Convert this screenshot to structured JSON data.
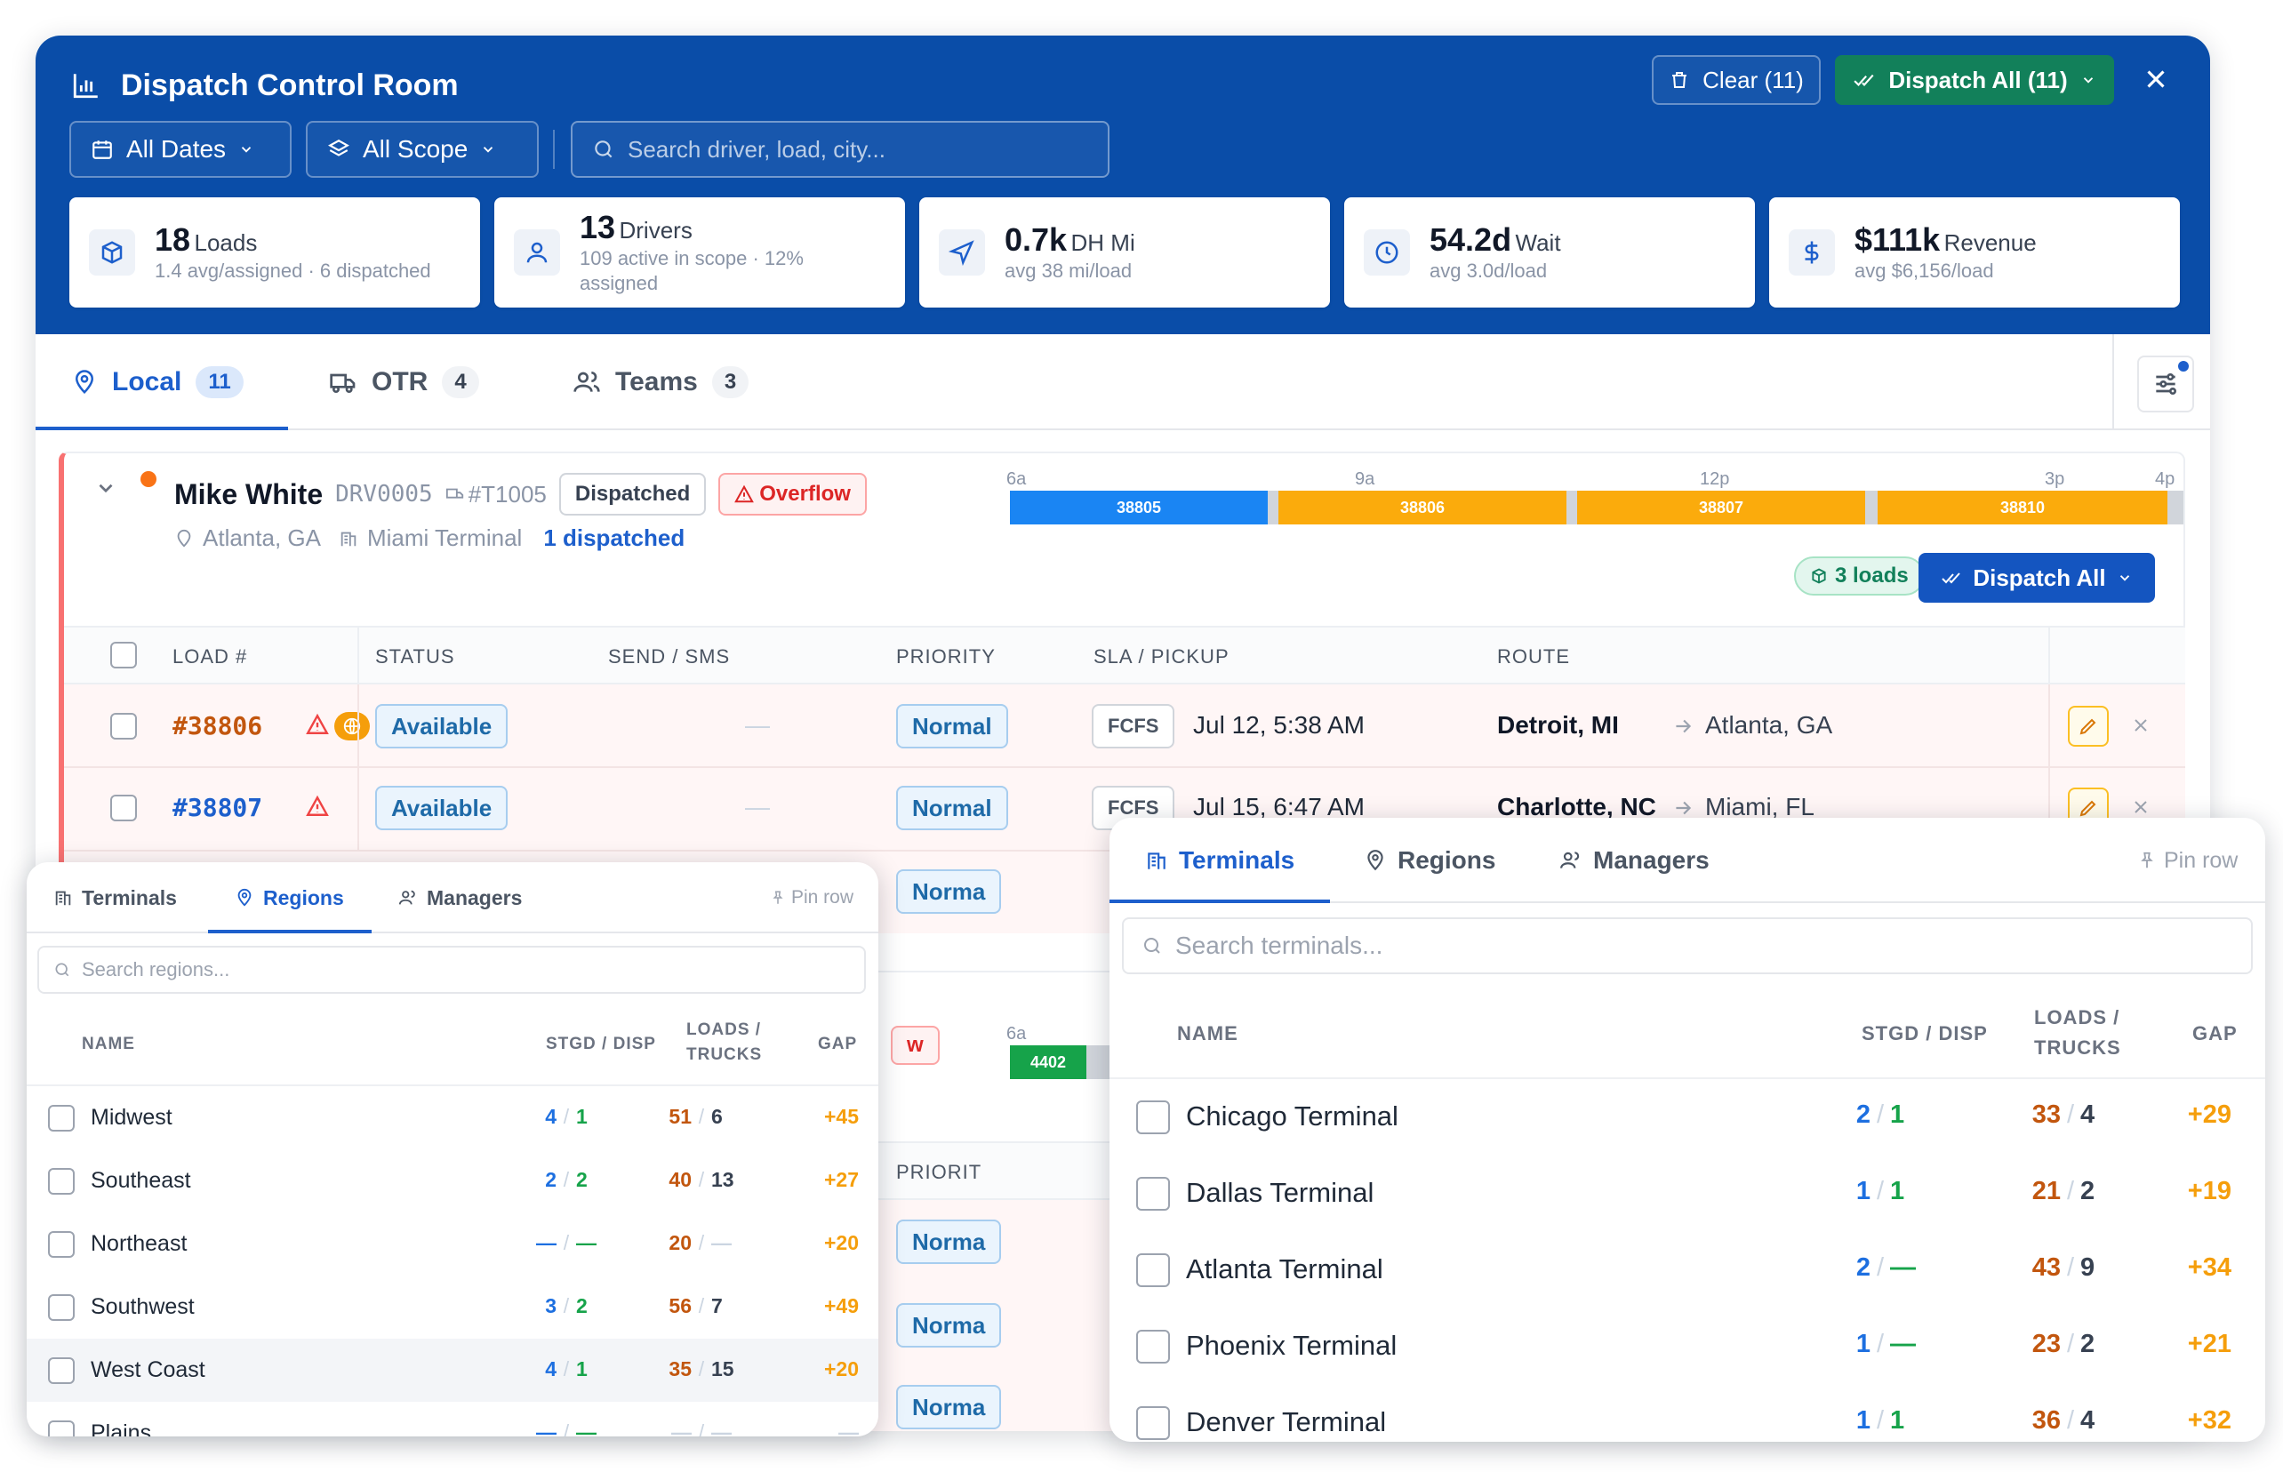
{
  "window": {
    "title": "Dispatch Control Room",
    "clear_label": "Clear (11)",
    "dispatch_all_label": "Dispatch All (11)"
  },
  "filters": {
    "dates": "All Dates",
    "scope": "All Scope",
    "search_placeholder": "Search driver, load, city..."
  },
  "stats": [
    {
      "value": "18",
      "label": "Loads",
      "sub": "1.4 avg/assigned · 6 dispatched",
      "icon": "box-icon"
    },
    {
      "value": "13",
      "label": "Drivers",
      "sub": "109 active in scope · 12% assigned",
      "icon": "user-icon"
    },
    {
      "value": "0.7k",
      "label": "DH Mi",
      "sub": "avg 38 mi/load",
      "icon": "navigation-icon"
    },
    {
      "value": "54.2d",
      "label": "Wait",
      "sub": "avg 3.0d/load",
      "icon": "clock-icon"
    },
    {
      "value": "$111k",
      "label": "Revenue",
      "sub": "avg $6,156/load",
      "icon": "dollar-icon"
    }
  ],
  "tabs": [
    {
      "label": "Local",
      "count": "11"
    },
    {
      "label": "OTR",
      "count": "4"
    },
    {
      "label": "Teams",
      "count": "3"
    }
  ],
  "driver": {
    "name": "Mike White",
    "id": "DRV0005",
    "truck": "#T1005",
    "status": "Dispatched",
    "flag": "Overflow",
    "city": "Atlanta, GA",
    "terminal": "Miami Terminal",
    "dispatched": "1 dispatched",
    "loads_badge": "3 loads",
    "dispatch_all": "Dispatch All"
  },
  "timeline": {
    "ticks": [
      "6a",
      "9a",
      "12p",
      "3p",
      "4p"
    ],
    "segments": [
      {
        "label": "38805",
        "color": "#1a85f3"
      },
      {
        "label": "38806",
        "color": "#fbab0c"
      },
      {
        "label": "38807",
        "color": "#fbab0c"
      },
      {
        "label": "38810",
        "color": "#fbab0c"
      }
    ]
  },
  "table": {
    "headers": [
      "LOAD #",
      "STATUS",
      "SEND / SMS",
      "PRIORITY",
      "SLA / PICKUP",
      "ROUTE"
    ],
    "rows": [
      {
        "load": "#38806",
        "status": "Available",
        "sms": "—",
        "priority": "Normal",
        "sla": "FCFS",
        "pickup": "Jul 12, 5:38 AM",
        "from": "Detroit, MI",
        "to": "Atlanta, GA"
      },
      {
        "load": "#38807",
        "status": "Available",
        "sms": "—",
        "priority": "Normal",
        "sla": "FCFS",
        "pickup": "Jul 15, 6:47 AM",
        "from": "Charlotte, NC",
        "to": "Miami, FL"
      }
    ],
    "hidden_priority": [
      "Norma",
      "Norma",
      "Norma",
      "Norma"
    ],
    "priority_hdr2": "PRIORIT"
  },
  "second_driver": {
    "tick": "6a",
    "segment": "4402",
    "flag_fragment": "w"
  },
  "regions_panel": {
    "tabs": [
      "Terminals",
      "Regions",
      "Managers"
    ],
    "pin": "Pin row",
    "search_placeholder": "Search regions...",
    "headers": {
      "name": "NAME",
      "stgd": "STGD / DISP",
      "loads": "LOADS /",
      "trucks": "TRUCKS",
      "gap": "GAP"
    },
    "rows": [
      {
        "name": "Midwest",
        "stgd": "4",
        "disp": "1",
        "loads": "51",
        "trucks": "6",
        "gap": "+45"
      },
      {
        "name": "Southeast",
        "stgd": "2",
        "disp": "2",
        "loads": "40",
        "trucks": "13",
        "gap": "+27"
      },
      {
        "name": "Northeast",
        "stgd": "—",
        "disp": "—",
        "loads": "20",
        "trucks": "—",
        "gap": "+20"
      },
      {
        "name": "Southwest",
        "stgd": "3",
        "disp": "2",
        "loads": "56",
        "trucks": "7",
        "gap": "+49"
      },
      {
        "name": "West Coast",
        "stgd": "4",
        "disp": "1",
        "loads": "35",
        "trucks": "15",
        "gap": "+20"
      },
      {
        "name": "Plains",
        "stgd": "—",
        "disp": "—",
        "loads": "—",
        "trucks": "—",
        "gap": "—"
      }
    ]
  },
  "terminals_panel": {
    "tabs": [
      "Terminals",
      "Regions",
      "Managers"
    ],
    "pin": "Pin row",
    "search_placeholder": "Search terminals...",
    "headers": {
      "name": "NAME",
      "stgd": "STGD / DISP",
      "loads": "LOADS /",
      "trucks": "TRUCKS",
      "gap": "GAP"
    },
    "rows": [
      {
        "name": "Chicago Terminal",
        "stgd": "2",
        "disp": "1",
        "loads": "33",
        "trucks": "4",
        "gap": "+29"
      },
      {
        "name": "Dallas Terminal",
        "stgd": "1",
        "disp": "1",
        "loads": "21",
        "trucks": "2",
        "gap": "+19"
      },
      {
        "name": "Atlanta Terminal",
        "stgd": "2",
        "disp": "—",
        "loads": "43",
        "trucks": "9",
        "gap": "+34"
      },
      {
        "name": "Phoenix Terminal",
        "stgd": "1",
        "disp": "—",
        "loads": "23",
        "trucks": "2",
        "gap": "+21"
      },
      {
        "name": "Denver Terminal",
        "stgd": "1",
        "disp": "1",
        "loads": "36",
        "trucks": "4",
        "gap": "+32"
      }
    ]
  },
  "colors": {
    "brand": "#0a4da8",
    "accent": "#1d5fcc",
    "success": "#12805a",
    "warning": "#fbab0c",
    "danger": "#ef4444"
  }
}
